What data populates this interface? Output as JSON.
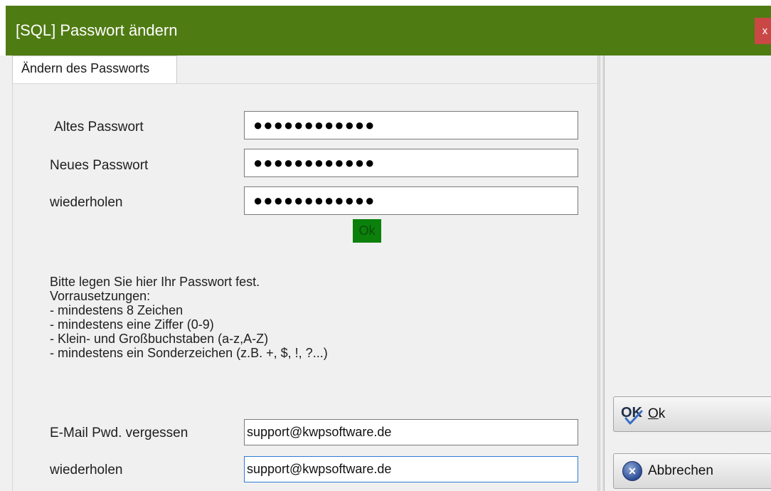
{
  "window": {
    "title": "[SQL] Passwort ändern",
    "close_label": "x"
  },
  "tab": {
    "label": "Ändern des Passworts"
  },
  "form": {
    "old_password_label": "Altes Passwort",
    "old_password_value": "●●●●●●●●●●●●",
    "new_password_label": "Neues Passwort",
    "new_password_value": "●●●●●●●●●●●●",
    "repeat_password_label": "wiederholen",
    "repeat_password_value": "●●●●●●●●●●●●",
    "validation_status": "Ok",
    "validation_color": "#0b800b"
  },
  "info": {
    "lines": [
      "Bitte legen Sie hier Ihr Passwort fest.",
      "Vorrausetzungen:",
      "- mindestens 8 Zeichen",
      "- mindestens eine Ziffer (0-9)",
      "- Klein- und Großbuchstaben (a-z,A-Z)",
      "- mindestens ein Sonderzeichen (z.B. +, $, !, ?...)"
    ]
  },
  "email": {
    "label": "E-Mail Pwd. vergessen",
    "value": "support@kwpsoftware.de",
    "repeat_label": "wiederholen",
    "repeat_value": "support@kwpsoftware.de"
  },
  "buttons": {
    "ok_label": "Ok",
    "ok_icon": "ok-check-icon",
    "cancel_label": "Abbrechen",
    "cancel_icon": "cancel-x-icon"
  },
  "colors": {
    "titlebar": "#4f7b13",
    "close": "#c94846"
  }
}
